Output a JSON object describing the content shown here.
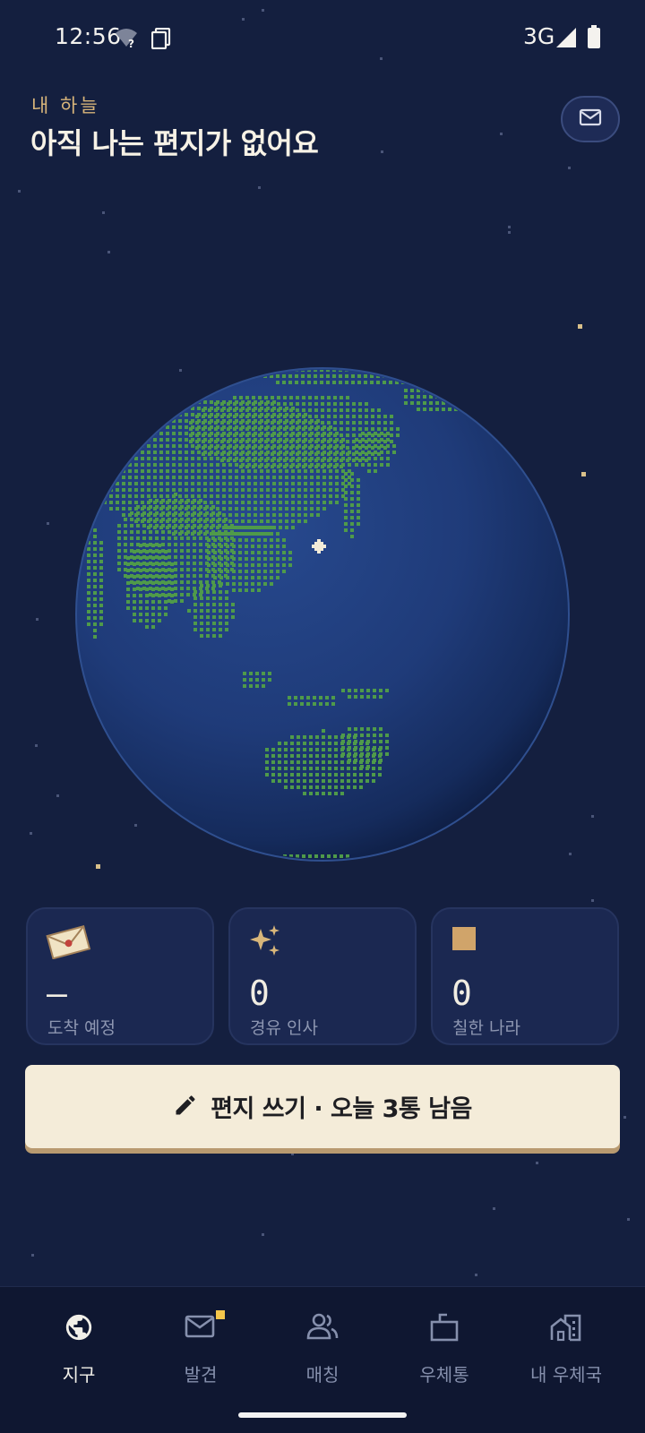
{
  "status_bar": {
    "time": "12:56",
    "network": "3G",
    "icons": [
      "wifi-unknown-icon",
      "sim-card-icon",
      "signal-icon",
      "battery-icon"
    ]
  },
  "header": {
    "subtitle": "내 하늘",
    "title": "아직 나는 편지가 없어요",
    "mail_icon": "mail-icon"
  },
  "stats": [
    {
      "icon": "envelope-icon",
      "value": "—",
      "label": "도착 예정"
    },
    {
      "icon": "sparkle-icon",
      "value": "0",
      "label": "경유 인사"
    },
    {
      "icon": "square-icon",
      "value": "0",
      "label": "칠한 나라"
    }
  ],
  "write_button": {
    "icon": "pencil-icon",
    "label": "편지 쓰기 · 오늘 3통 남음"
  },
  "nav": [
    {
      "icon": "globe-icon",
      "label": "지구",
      "active": true
    },
    {
      "icon": "mail-icon",
      "label": "발견",
      "badge": true
    },
    {
      "icon": "people-icon",
      "label": "매칭"
    },
    {
      "icon": "mailbox-icon",
      "label": "우체통"
    },
    {
      "icon": "post-office-icon",
      "label": "내 우체국"
    }
  ],
  "colors": {
    "background": "#141f3f",
    "accent_gold": "#d7b47a",
    "land_green": "#4f9a4a",
    "ocean": "#1e3a78",
    "button_cream": "#f4ecd9",
    "badge_yellow": "#f4c64b"
  }
}
